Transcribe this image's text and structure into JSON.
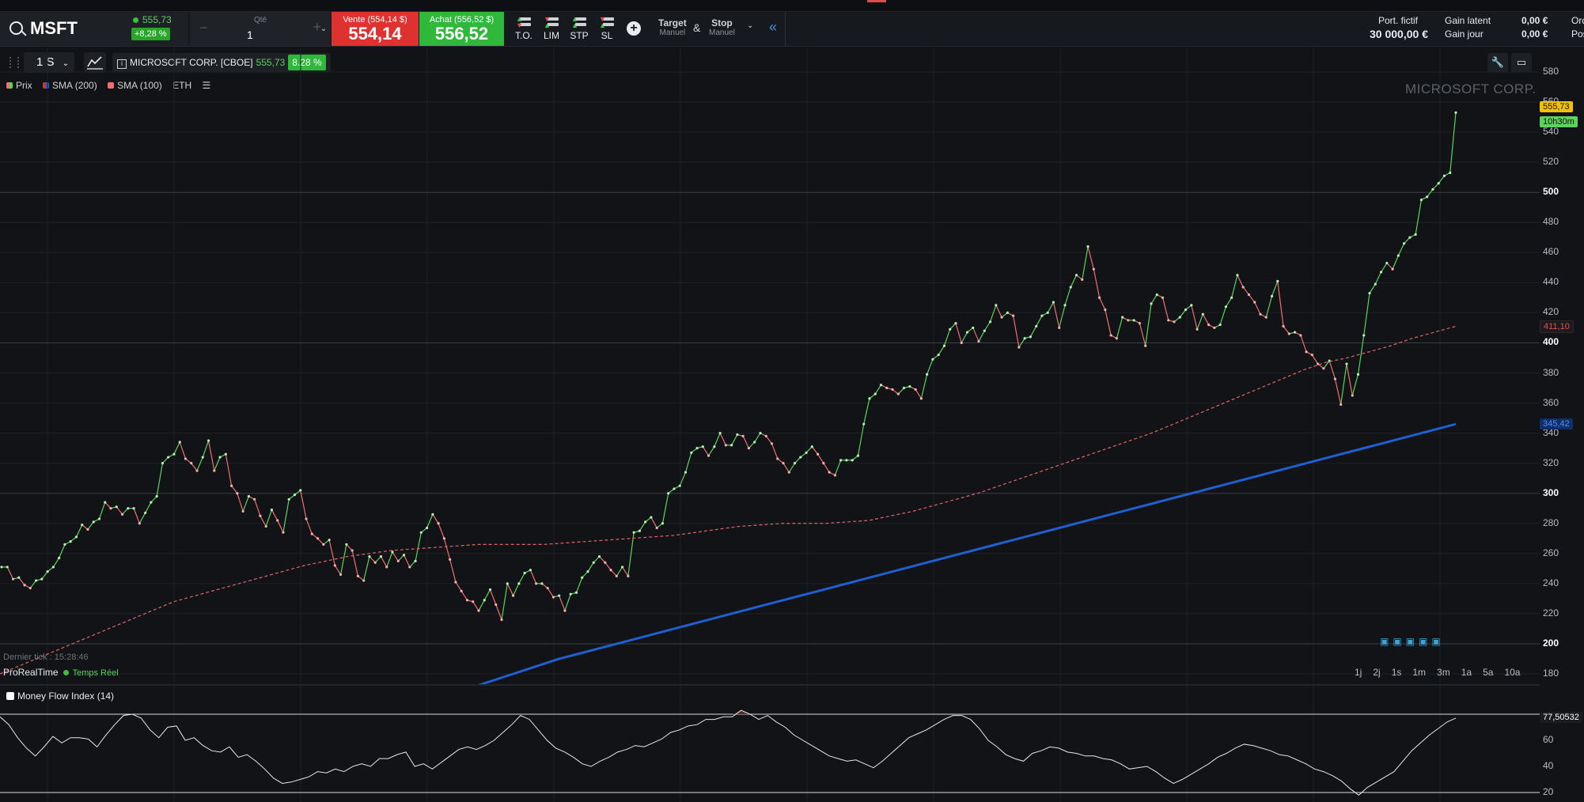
{
  "order_bar": {
    "symbol": "MSFT",
    "last_price": "555,73",
    "change_pct": "+8,28 %",
    "qty_label": "Qté",
    "qty_value": "1",
    "qty_minus": "−",
    "qty_plus": "+",
    "sell_label": "Vente (554,14 $)",
    "sell_price": "554,14",
    "buy_label": "Achat (556,52 $)",
    "buy_price": "556,52",
    "order_types": [
      "T.O.",
      "LIM",
      "STP",
      "SL"
    ],
    "add_label": "+",
    "target_label": "Target",
    "target_sub": "Manuel",
    "amp": "&",
    "stop_label": "Stop",
    "stop_sub": "Manuel",
    "collapse_label": "«",
    "port_label": "Port. fictif",
    "port_value": "30 000,00 €",
    "gain_latent_label": "Gain latent",
    "gain_latent_value": "0,00 €",
    "gain_jour_label": "Gain jour",
    "gain_jour_value": "0,00 €",
    "ord_label": "Ord",
    "pos_label": "Pos"
  },
  "chart_toolbar": {
    "period": "1 S",
    "instrument": "MICROSOFT CORP. [CBOE]",
    "instrument_price": "555,73",
    "instrument_pct": "8.28 %"
  },
  "legend": [
    {
      "label": "Prix",
      "color": "#5cd35c"
    },
    {
      "label": "SMA (200)",
      "color": "#1f5fd0"
    },
    {
      "label": "SMA (100)",
      "color": "#f07070"
    },
    {
      "label": "ETH",
      "color": ""
    }
  ],
  "watermark": "MICROSOFT CORP.",
  "badges": {
    "price": "555,73",
    "time": "10h30m",
    "sma100": "411,10",
    "sma200": "345,42",
    "mfi": "77,50532"
  },
  "last_tick": "Dernier tick : 15:28:46",
  "prt": {
    "name": "ProRealTime",
    "realtime": "Temps Réel"
  },
  "ranges": [
    "1j",
    "2j",
    "1s",
    "1m",
    "3m",
    "1a",
    "5a",
    "10a"
  ],
  "mfi_title": "Money Flow Index (14)",
  "colors": {
    "up": "#5cd35c",
    "down": "#f07070",
    "sma200": "#1f5fd0",
    "sma100": "#e06666",
    "sell": "#e03131",
    "buy": "#2fb83a"
  },
  "chart_data": [
    {
      "type": "line",
      "ylim": [
        170,
        590
      ],
      "yticks": [
        180,
        200,
        220,
        240,
        260,
        280,
        300,
        320,
        340,
        360,
        380,
        400,
        420,
        440,
        460,
        480,
        500,
        520,
        540,
        560,
        580
      ],
      "series": [
        {
          "name": "Prix",
          "values": [
            251,
            251,
            243,
            244,
            239,
            237,
            242,
            243,
            248,
            251,
            257,
            266,
            268,
            271,
            279,
            276,
            281,
            283,
            294,
            290,
            291,
            286,
            290,
            290,
            280,
            287,
            294,
            298,
            320,
            324,
            326,
            334,
            323,
            320,
            315,
            324,
            335,
            315,
            324,
            326,
            305,
            300,
            288,
            298,
            296,
            285,
            278,
            289,
            282,
            274,
            296,
            299,
            302,
            283,
            273,
            270,
            266,
            269,
            252,
            246,
            266,
            262,
            245,
            242,
            258,
            254,
            258,
            251,
            261,
            255,
            259,
            251,
            255,
            274,
            277,
            286,
            280,
            270,
            256,
            241,
            235,
            229,
            228,
            222,
            229,
            236,
            226,
            216,
            240,
            232,
            240,
            247,
            249,
            240,
            240,
            237,
            231,
            232,
            222,
            233,
            234,
            244,
            248,
            254,
            258,
            254,
            249,
            245,
            251,
            245,
            274,
            275,
            281,
            284,
            277,
            280,
            300,
            303,
            305,
            314,
            327,
            330,
            331,
            325,
            331,
            340,
            332,
            332,
            339,
            338,
            330,
            334,
            340,
            338,
            333,
            323,
            320,
            314,
            320,
            324,
            327,
            331,
            326,
            320,
            314,
            312,
            322,
            322,
            322,
            325,
            346,
            363,
            366,
            372,
            370,
            369,
            366,
            370,
            371,
            369,
            363,
            379,
            389,
            392,
            398,
            409,
            413,
            400,
            407,
            410,
            401,
            408,
            414,
            425,
            417,
            420,
            418,
            397,
            403,
            404,
            411,
            418,
            420,
            427,
            410,
            425,
            437,
            445,
            442,
            464,
            449,
            430,
            422,
            405,
            403,
            417,
            415,
            415,
            413,
            398,
            426,
            432,
            430,
            415,
            414,
            417,
            422,
            425,
            409,
            419,
            412,
            410,
            412,
            424,
            430,
            445,
            437,
            432,
            427,
            419,
            417,
            431,
            441,
            411,
            406,
            407,
            405,
            394,
            392,
            386,
            383,
            388,
            376,
            359,
            386,
            365,
            379,
            405,
            433,
            439,
            447,
            453,
            449,
            458,
            466,
            470,
            472,
            495,
            497,
            502,
            506,
            511,
            513,
            553
          ]
        },
        {
          "name": "SMA (200)",
          "values": [
            120,
            125,
            130,
            135,
            140,
            145,
            150,
            155,
            160,
            165,
            170,
            175,
            180,
            185,
            190,
            194,
            198,
            202,
            206,
            210,
            214,
            218,
            222,
            226,
            230,
            234,
            238,
            242,
            246,
            250,
            254,
            258,
            262,
            266,
            270,
            274,
            278,
            282,
            286,
            290,
            294,
            298,
            302,
            306,
            310,
            314,
            318,
            322,
            326,
            330,
            334,
            338,
            342,
            346
          ]
        },
        {
          "name": "SMA (100)",
          "values": [
            180,
            186,
            192,
            198,
            204,
            210,
            216,
            222,
            228,
            232,
            236,
            240,
            244,
            248,
            252,
            255,
            258,
            260,
            262,
            263,
            264,
            265,
            266,
            266,
            266,
            266,
            267,
            268,
            269,
            270,
            271,
            272,
            274,
            276,
            278,
            279,
            280,
            280,
            280,
            281,
            282,
            285,
            288,
            292,
            296,
            300,
            305,
            310,
            315,
            320,
            325,
            330,
            335,
            340,
            346,
            352,
            358,
            364,
            370,
            376,
            382,
            387,
            390,
            394,
            398,
            403,
            407,
            411
          ]
        }
      ]
    },
    {
      "type": "line",
      "ylim": [
        18,
        88
      ],
      "yticks": [
        20,
        40,
        60
      ],
      "series": [
        {
          "name": "Money Flow Index (14)",
          "values": [
            78,
            72,
            62,
            54,
            48,
            55,
            63,
            58,
            62,
            62,
            61,
            55,
            64,
            72,
            79,
            80,
            77,
            68,
            62,
            70,
            71,
            60,
            62,
            56,
            52,
            51,
            55,
            47,
            49,
            44,
            38,
            31,
            27,
            28,
            30,
            32,
            36,
            35,
            38,
            36,
            40,
            42,
            40,
            46,
            46,
            49,
            51,
            40,
            42,
            38,
            43,
            48,
            53,
            55,
            53,
            56,
            60,
            66,
            72,
            79,
            76,
            68,
            60,
            54,
            51,
            47,
            42,
            40,
            44,
            47,
            51,
            53,
            56,
            55,
            58,
            61,
            66,
            68,
            71,
            72,
            76,
            76,
            78,
            78,
            83,
            80,
            76,
            79,
            74,
            70,
            64,
            60,
            56,
            52,
            48,
            46,
            44,
            45,
            42,
            39,
            44,
            50,
            56,
            62,
            65,
            68,
            72,
            76,
            79,
            79,
            76,
            69,
            60,
            55,
            49,
            46,
            44,
            50,
            52,
            55,
            54,
            51,
            50,
            48,
            48,
            46,
            45,
            42,
            38,
            39,
            40,
            36,
            31,
            27,
            30,
            34,
            38,
            42,
            47,
            50,
            54,
            57,
            56,
            54,
            52,
            49,
            48,
            45,
            42,
            38,
            36,
            33,
            29,
            23,
            18,
            24,
            28,
            32,
            36,
            44,
            52,
            58,
            64,
            69,
            74,
            77
          ]
        }
      ]
    }
  ]
}
